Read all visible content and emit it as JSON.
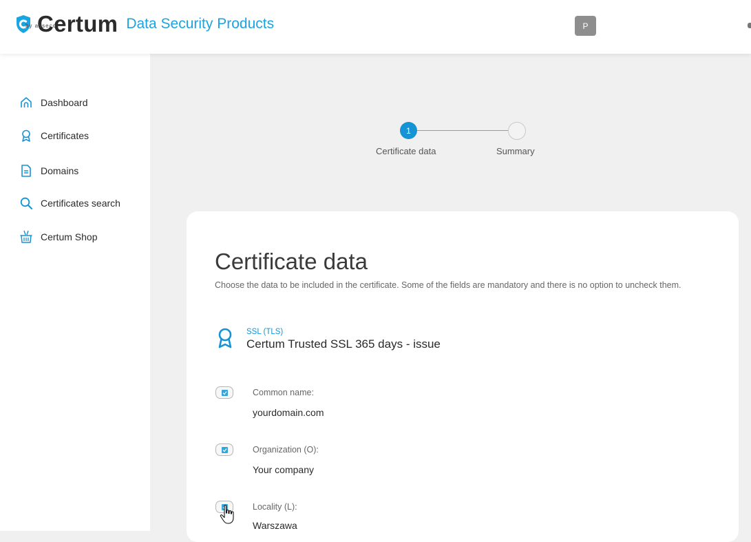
{
  "header": {
    "brand": "Certum",
    "brand_sub": "by asseco",
    "product_line": "Data Security Products",
    "avatar_letter": "P",
    "brand_color": "#1aa4e2"
  },
  "sidebar": {
    "items": [
      {
        "label": "Dashboard",
        "icon": "home-icon"
      },
      {
        "label": "Certificates",
        "icon": "ribbon-icon"
      },
      {
        "label": "Domains",
        "icon": "document-icon"
      },
      {
        "label": "Certificates search",
        "icon": "search-icon"
      },
      {
        "label": "Certum Shop",
        "icon": "basket-icon"
      }
    ]
  },
  "stepper": {
    "steps": [
      {
        "number": "1",
        "label": "Certificate data",
        "active": true
      },
      {
        "number": "",
        "label": "Summary",
        "active": false
      }
    ]
  },
  "card": {
    "title": "Certificate data",
    "description": "Choose the data to be included in the certificate. Some of the fields are mandatory and there is no option to uncheck them.",
    "product_type": "SSL (TLS)",
    "product_name": "Certum Trusted SSL 365 days - issue",
    "fields": [
      {
        "label": "Common name:",
        "value": "yourdomain.com",
        "checked": true
      },
      {
        "label": "Organization (O):",
        "value": "Your company",
        "checked": true
      },
      {
        "label": "Locality (L):",
        "value": "Warszawa",
        "checked": true
      }
    ]
  },
  "colors": {
    "accent": "#1693d5",
    "checkbox": "#35a5dc"
  }
}
